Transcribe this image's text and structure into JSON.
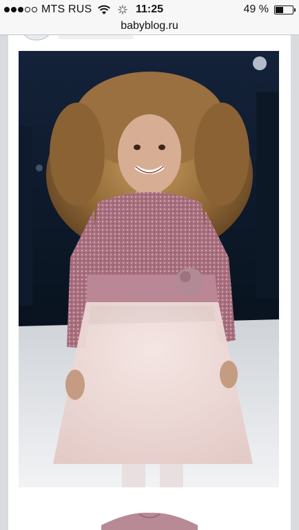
{
  "status_bar": {
    "carrier": "MTS RUS",
    "time": "11:25",
    "battery_text": "49 %",
    "battery_level": 0.49,
    "signal_filled": 3,
    "signal_total": 5,
    "icons": [
      "wifi-icon",
      "activity-spinner-icon",
      "battery-icon"
    ]
  },
  "browser": {
    "url": "babyblog.ru"
  },
  "post": {
    "images": [
      "runway-photo-girl-pink-dress",
      "dress-photo-partial"
    ]
  }
}
